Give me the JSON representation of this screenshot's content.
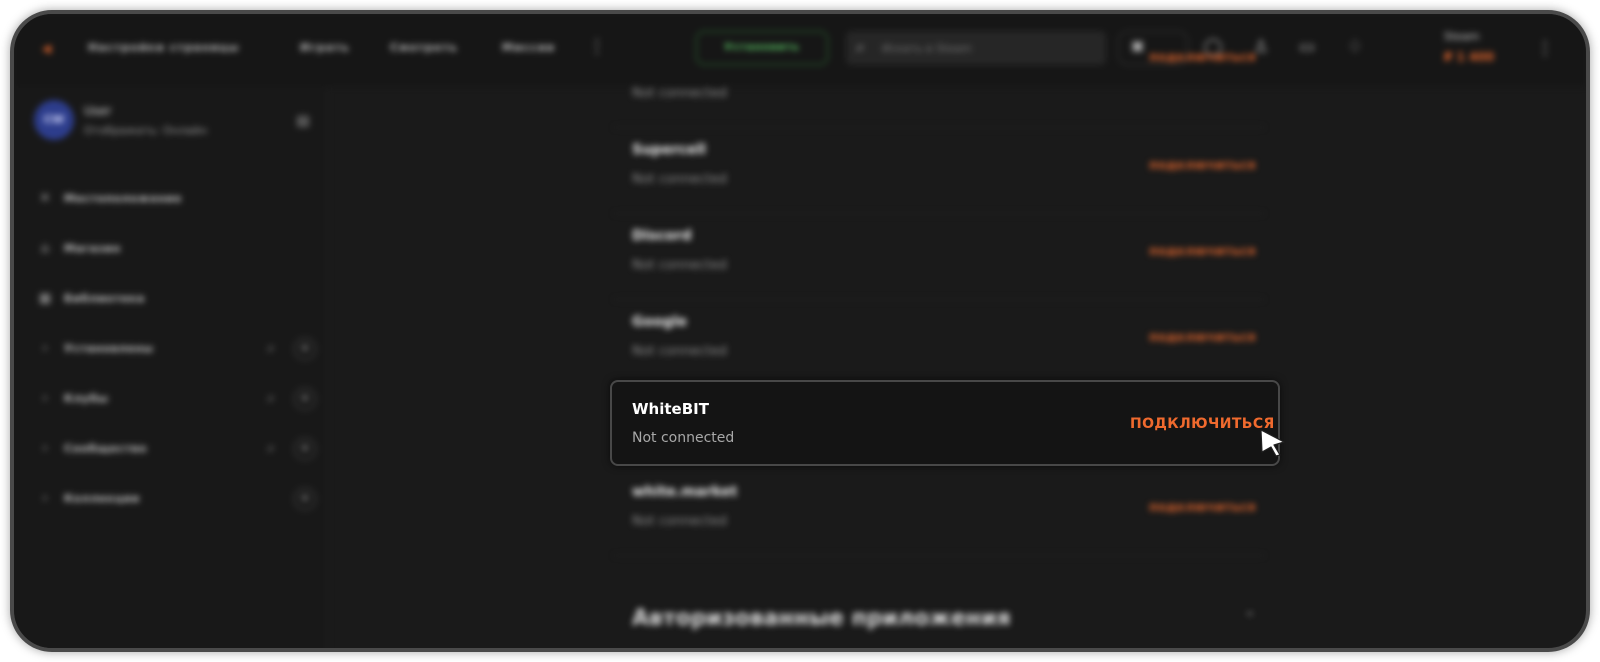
{
  "topbar": {
    "nav": [
      "Настройки страницы",
      "Играть",
      "Смотреть",
      "Миссии"
    ],
    "install_label": "Установить",
    "search_placeholder": "Искать в Steam",
    "user_name": "Steam",
    "balance": "₽ 1 400"
  },
  "sidebar": {
    "profile": {
      "initials": "CW",
      "name": "User",
      "status": "Отображать: Онлайн"
    },
    "items": [
      {
        "label": "Местоположение",
        "icon": "close-icon"
      },
      {
        "label": "Магазин",
        "icon": "bag-icon"
      },
      {
        "label": "Библиотека",
        "icon": "grid-icon"
      },
      {
        "label": "Установлены",
        "icon": "chevron-right-icon"
      },
      {
        "label": "Клубы",
        "icon": "chevron-right-icon"
      },
      {
        "label": "Сообщество",
        "icon": "chevron-right-icon"
      },
      {
        "label": "Коллекции",
        "icon": "chevron-right-icon"
      }
    ]
  },
  "connections": {
    "rows": [
      {
        "name": "",
        "status": "Not connected",
        "action": "подключиться"
      },
      {
        "name": "Supercell",
        "status": "Not connected",
        "action": "подключиться"
      },
      {
        "name": "Discord",
        "status": "Not connected",
        "action": "подключиться"
      },
      {
        "name": "Google",
        "status": "Not connected",
        "action": "подключиться"
      }
    ],
    "focused": {
      "name": "WhiteBIT",
      "status": "Not connected",
      "action": "ПОДКЛЮЧИТЬСЯ"
    },
    "after": {
      "name": "white.market",
      "status": "Not connected",
      "action": "подключиться"
    },
    "section_title": "Авторизованные приложения"
  },
  "colors": {
    "accent": "#e0652d",
    "install_green": "#5fd36a",
    "background": "#1a1a1a"
  }
}
